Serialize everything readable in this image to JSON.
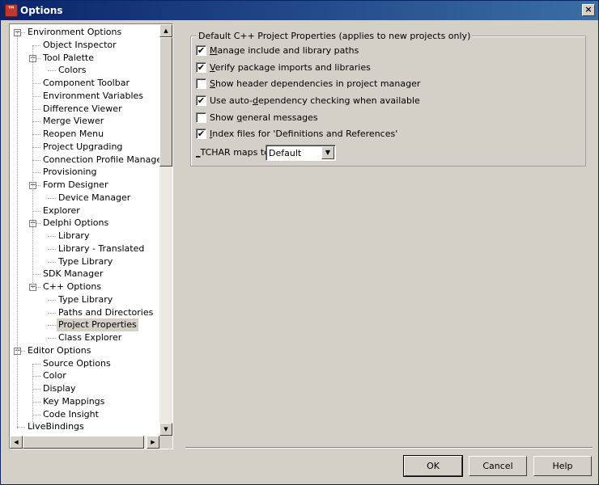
{
  "window": {
    "title": "Options",
    "icon": "rad-studio-icon",
    "close_label": "×"
  },
  "tree": {
    "items": [
      {
        "label": "Environment Options",
        "level": 0,
        "expander": "−"
      },
      {
        "label": "Object Inspector",
        "level": 1
      },
      {
        "label": "Tool Palette",
        "level": 1,
        "expander": "−"
      },
      {
        "label": "Colors",
        "level": 2
      },
      {
        "label": "Component Toolbar",
        "level": 1
      },
      {
        "label": "Environment Variables",
        "level": 1
      },
      {
        "label": "Difference Viewer",
        "level": 1
      },
      {
        "label": "Merge Viewer",
        "level": 1
      },
      {
        "label": "Reopen Menu",
        "level": 1
      },
      {
        "label": "Project Upgrading",
        "level": 1
      },
      {
        "label": "Connection Profile Manager",
        "level": 1
      },
      {
        "label": "Provisioning",
        "level": 1
      },
      {
        "label": "Form Designer",
        "level": 1,
        "expander": "−"
      },
      {
        "label": "Device Manager",
        "level": 2
      },
      {
        "label": "Explorer",
        "level": 1
      },
      {
        "label": "Delphi Options",
        "level": 1,
        "expander": "−"
      },
      {
        "label": "Library",
        "level": 2
      },
      {
        "label": "Library - Translated",
        "level": 2
      },
      {
        "label": "Type Library",
        "level": 2
      },
      {
        "label": "SDK Manager",
        "level": 1
      },
      {
        "label": "C++ Options",
        "level": 1,
        "expander": "−"
      },
      {
        "label": "Type Library",
        "level": 2
      },
      {
        "label": "Paths and Directories",
        "level": 2
      },
      {
        "label": "Project Properties",
        "level": 2,
        "selected": true
      },
      {
        "label": "Class Explorer",
        "level": 2
      },
      {
        "label": "Editor Options",
        "level": 0,
        "expander": "−"
      },
      {
        "label": "Source Options",
        "level": 1
      },
      {
        "label": "Color",
        "level": 1
      },
      {
        "label": "Display",
        "level": 1
      },
      {
        "label": "Key Mappings",
        "level": 1
      },
      {
        "label": "Code Insight",
        "level": 1
      },
      {
        "label": "LiveBindings",
        "level": 0
      }
    ]
  },
  "group": {
    "title": "Default C++ Project Properties (applies to new projects only)",
    "options": [
      {
        "pre": "",
        "accel": "M",
        "post": "anage include and library paths",
        "checked": true
      },
      {
        "pre": "",
        "accel": "V",
        "post": "erify package imports and libraries",
        "checked": true
      },
      {
        "pre": "",
        "accel": "S",
        "post": "how header dependencies in project manager",
        "checked": false
      },
      {
        "pre": "Use auto-",
        "accel": "d",
        "post": "ependency checking when available",
        "checked": true
      },
      {
        "pre": "Show ",
        "accel": "g",
        "post": "eneral messages",
        "checked": false
      },
      {
        "pre": "",
        "accel": "I",
        "post": "ndex files for 'Definitions and References'",
        "checked": true
      }
    ],
    "tchar": {
      "accel": "_",
      "label": "TCHAR maps to",
      "value": "Default"
    }
  },
  "buttons": {
    "ok": "OK",
    "cancel": "Cancel",
    "help": "Help"
  }
}
